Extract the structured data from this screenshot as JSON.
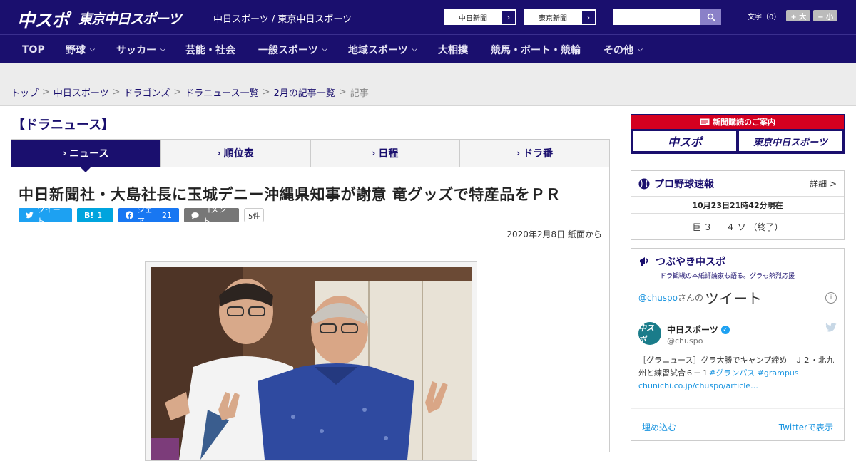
{
  "header": {
    "logo_chuspo": "中スポ",
    "logo_tokyo": "東京中日スポーツ",
    "site_name": "中日スポーツ / 東京中日スポーツ",
    "ext_links": [
      "中日新聞",
      "東京新聞"
    ],
    "font_label": "文字（0）",
    "font_larger": "+ 大",
    "font_smaller": "− 小"
  },
  "nav": {
    "items": [
      "TOP",
      "野球",
      "サッカー",
      "芸能・社会",
      "一般スポーツ",
      "地域スポーツ",
      "大相撲",
      "競馬・ボート・競輪",
      "その他"
    ]
  },
  "breadcrumb": {
    "items": [
      "トップ",
      "中日スポーツ",
      "ドラゴンズ",
      "ドラニュース一覧",
      "2月の記事一覧"
    ],
    "current": "記事"
  },
  "main": {
    "section_title": "【ドラニュース】",
    "tabs": [
      "ニュース",
      "順位表",
      "日程",
      "ドラ番"
    ],
    "headline": "中日新聞社・大島社長に玉城デニー沖縄県知事が謝意 竜グッズで特産品をＰＲ",
    "social": {
      "tweet": "ツイート",
      "hatena_icon": "B!",
      "hatena_count": "1",
      "share": "シェア",
      "share_count": "21",
      "comment": "コメント",
      "comment_count": "5件"
    },
    "date": "2020年2月8日 紙面から"
  },
  "sidebar": {
    "subscription_banner": "新聞購読のご案内",
    "subscription_logos": [
      "中スポ",
      "東京中日スポーツ"
    ],
    "baseball": {
      "title": "プロ野球速報",
      "more": "詳細 >",
      "time": "10月23日21時42分現在",
      "score": "巨 ３ － ４ ソ （終了）"
    },
    "tweets": {
      "title": "つぶやき中スポ",
      "subtitle": "ドラ観戦の本紙評論家も語る。グラも熱烈応援",
      "handle": "@chuspo",
      "san": "さんの",
      "tweet_word": "ツイート",
      "item": {
        "avatar": "中スポ",
        "name": "中日スポーツ",
        "handle": "@chuspo",
        "text": "［グラニュース］グラ大勝でキャンプ締め　Ｊ２・北九州と練習試合６－１",
        "hashtags": "#グランパス #grampus",
        "link": "chunichi.co.jp/chuspo/article…"
      },
      "embed": "埋め込む",
      "view_on_twitter": "Twitterで表示"
    }
  }
}
